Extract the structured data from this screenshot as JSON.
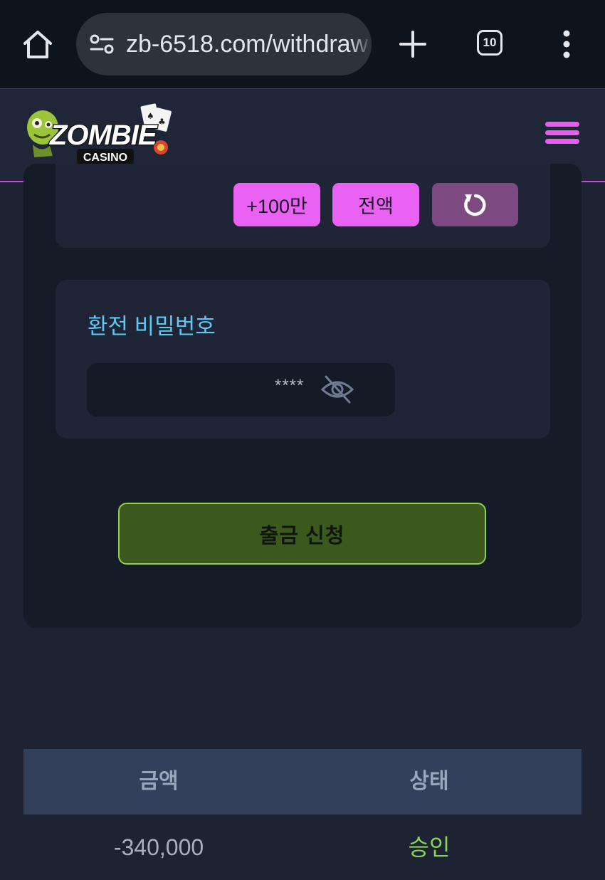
{
  "browser": {
    "url": "zb-6518.com/withdraw",
    "tab_count": "10",
    "icons": [
      "home-icon",
      "site-info-icon",
      "plus-icon",
      "tabs-icon",
      "more-vertical-icon"
    ]
  },
  "header": {
    "logo_main": "ZOMBIE",
    "logo_sub": "CASINO",
    "menu_icon": "hamburger-icon",
    "accent": "#e85cf0"
  },
  "amount": {
    "btn_100man": "+100만",
    "btn_all": "전액",
    "reset_icon": "refresh-icon"
  },
  "password": {
    "label": "환전 비밀번호",
    "value": "****",
    "toggle_icon": "eye-off-icon",
    "label_color": "#5fc7f0"
  },
  "submit": {
    "label": "출금 신청",
    "color": "#3b591c"
  },
  "history": {
    "columns": [
      "금액",
      "상태"
    ],
    "rows": [
      {
        "amount": "-340,000",
        "status": "승인"
      }
    ],
    "status_color": "#8bd255"
  }
}
